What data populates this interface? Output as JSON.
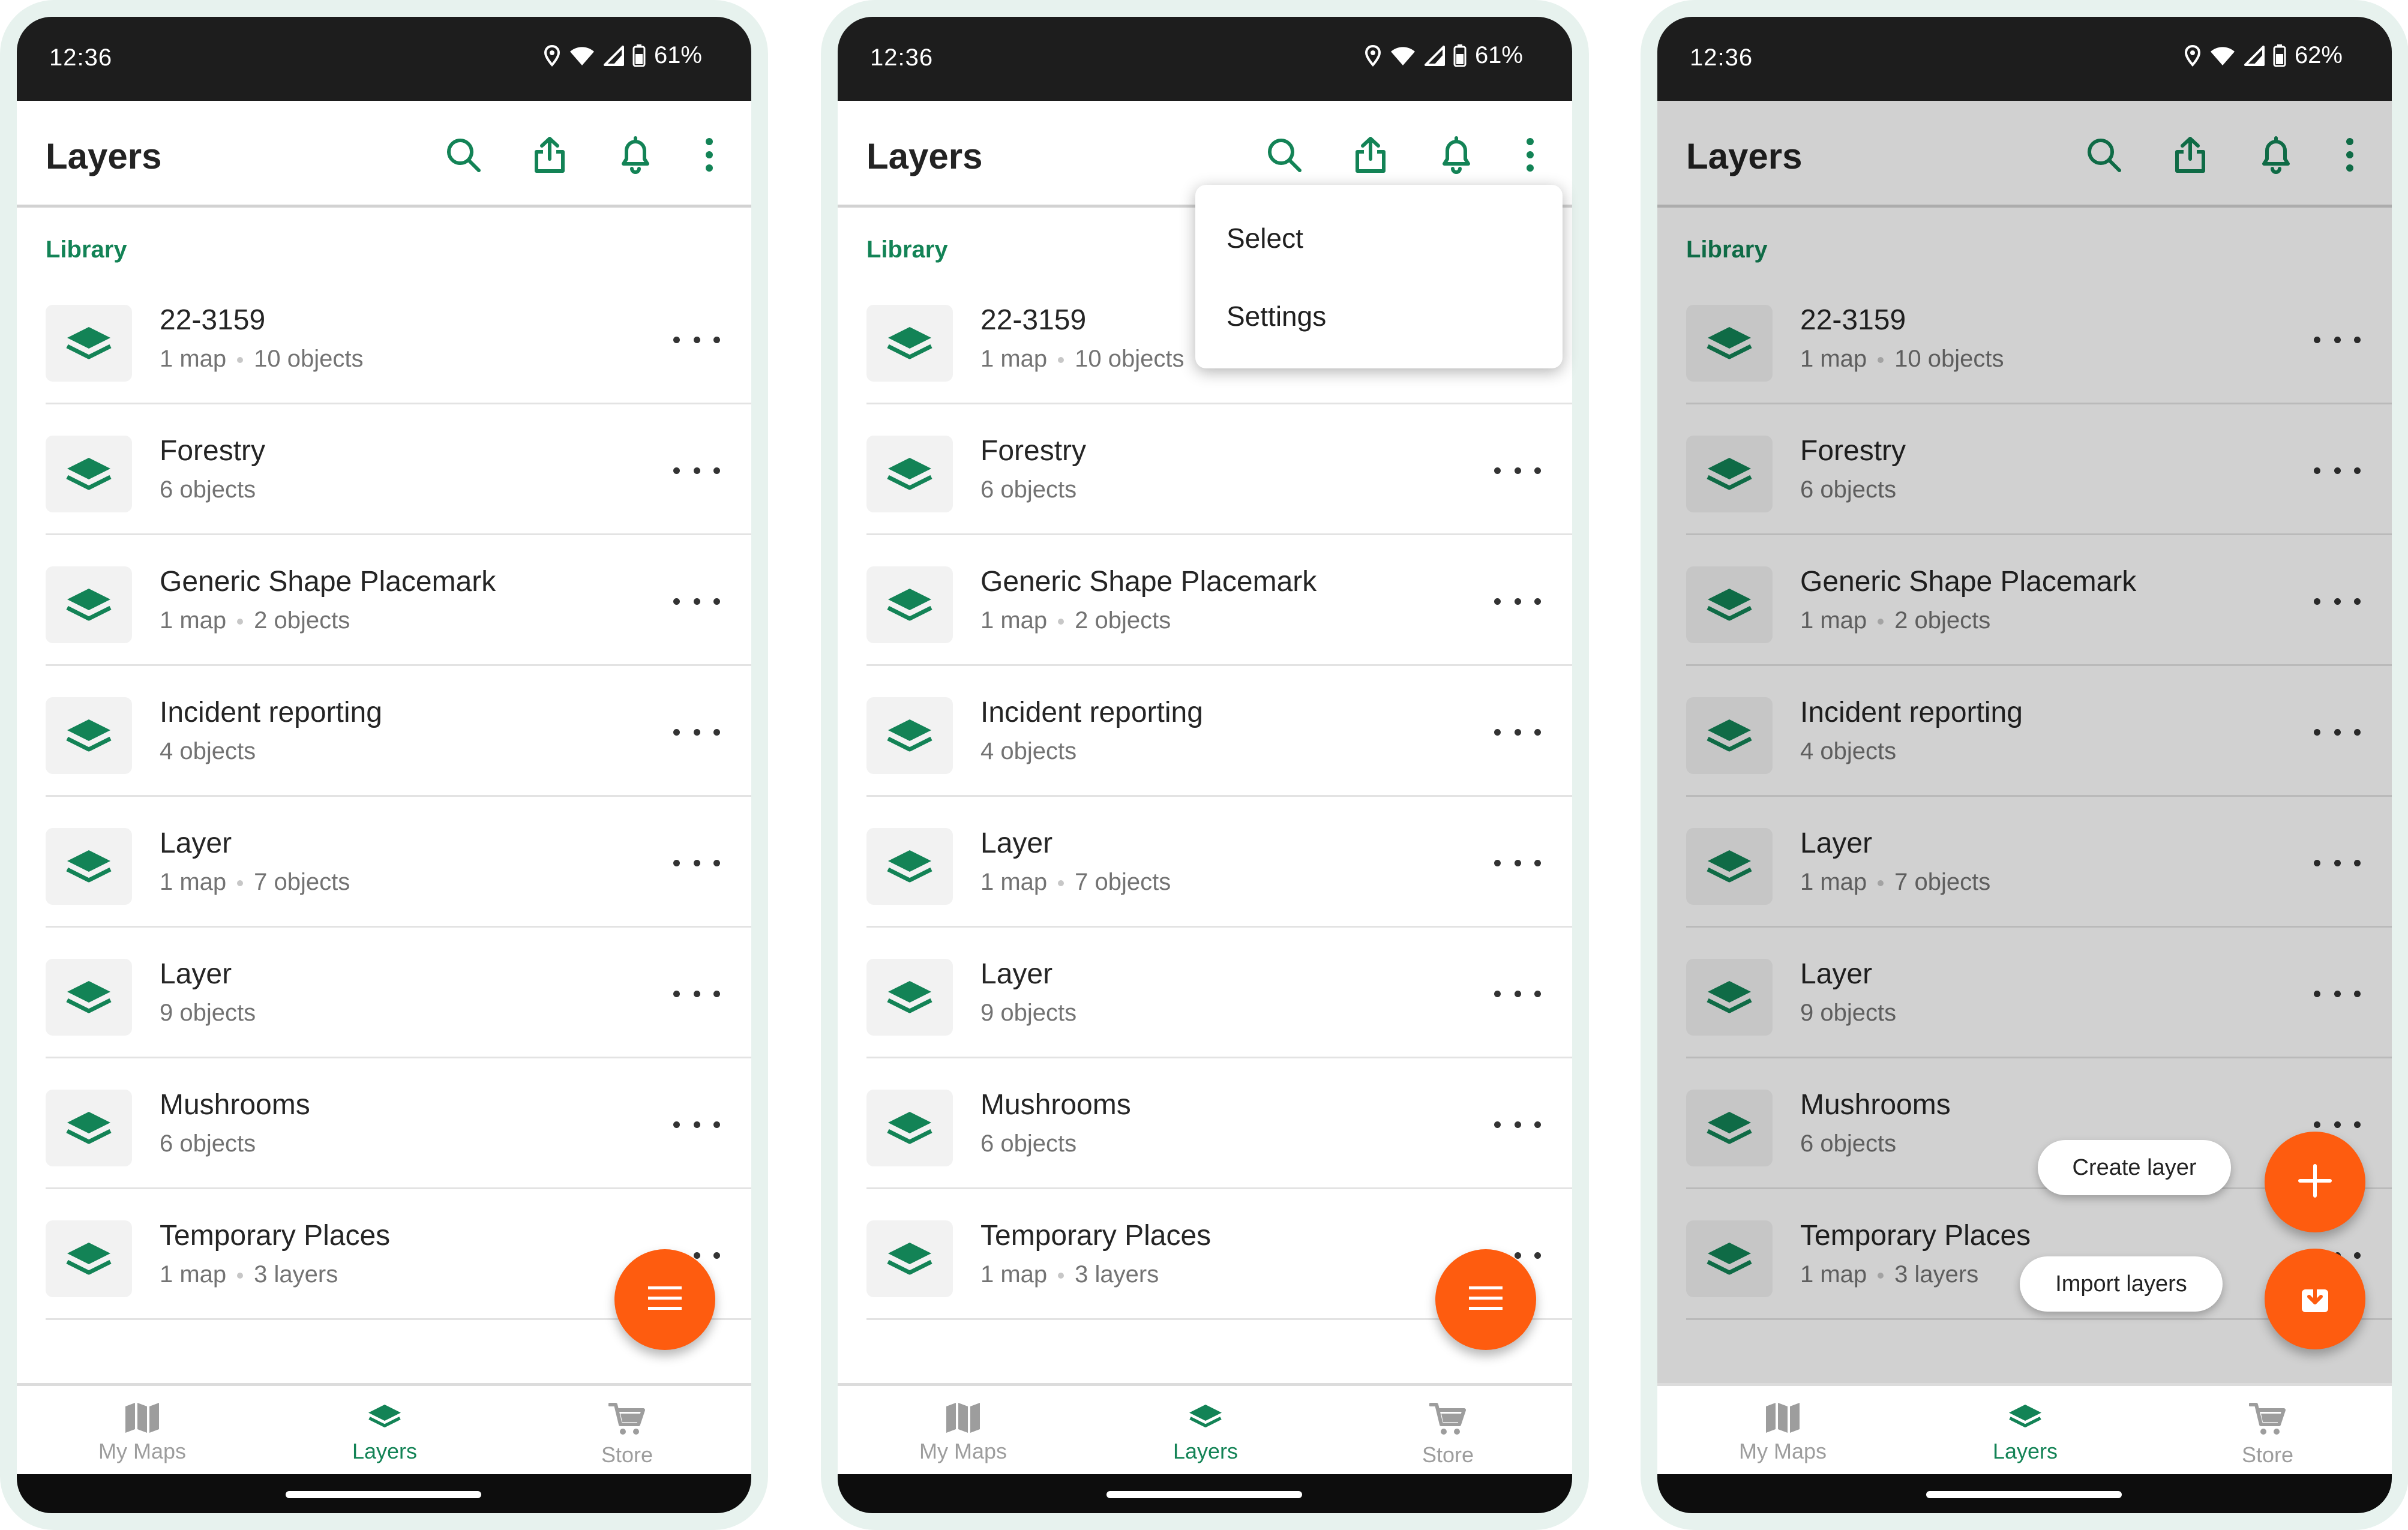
{
  "app": {
    "title": "Layers",
    "section": "Library",
    "brand_color": "#138356",
    "fab_color": "#fe5c0f"
  },
  "screens": [
    {
      "time": "12:36",
      "battery": "61%"
    },
    {
      "time": "12:36",
      "battery": "61%"
    },
    {
      "time": "12:36",
      "battery": "62%"
    }
  ],
  "layers": [
    {
      "title": "22-3159",
      "sub1": "1 map",
      "sub2": "10 objects"
    },
    {
      "title": "Forestry",
      "sub1": "6 objects",
      "sub2": ""
    },
    {
      "title": "Generic Shape Placemark",
      "sub1": "1 map",
      "sub2": "2 objects"
    },
    {
      "title": "Incident reporting",
      "sub1": "4 objects",
      "sub2": ""
    },
    {
      "title": "Layer",
      "sub1": "1 map",
      "sub2": "7 objects"
    },
    {
      "title": "Layer",
      "sub1": "9 objects",
      "sub2": ""
    },
    {
      "title": "Mushrooms",
      "sub1": "6 objects",
      "sub2": ""
    },
    {
      "title": "Temporary Places",
      "sub1": "1 map",
      "sub2": "3 layers"
    }
  ],
  "nav": [
    {
      "label": "My Maps",
      "icon": "map-icon"
    },
    {
      "label": "Layers",
      "icon": "layers-icon",
      "active": true
    },
    {
      "label": "Store",
      "icon": "cart-icon"
    }
  ],
  "overflow_menu": [
    "Select",
    "Settings"
  ],
  "fab_actions": {
    "create": "Create layer",
    "import": "Import layers"
  },
  "icons": [
    "search-icon",
    "share-icon",
    "bell-icon",
    "more-vertical-icon",
    "layers-icon",
    "more-horizontal-icon",
    "hamburger-icon",
    "plus-icon",
    "import-icon"
  ]
}
